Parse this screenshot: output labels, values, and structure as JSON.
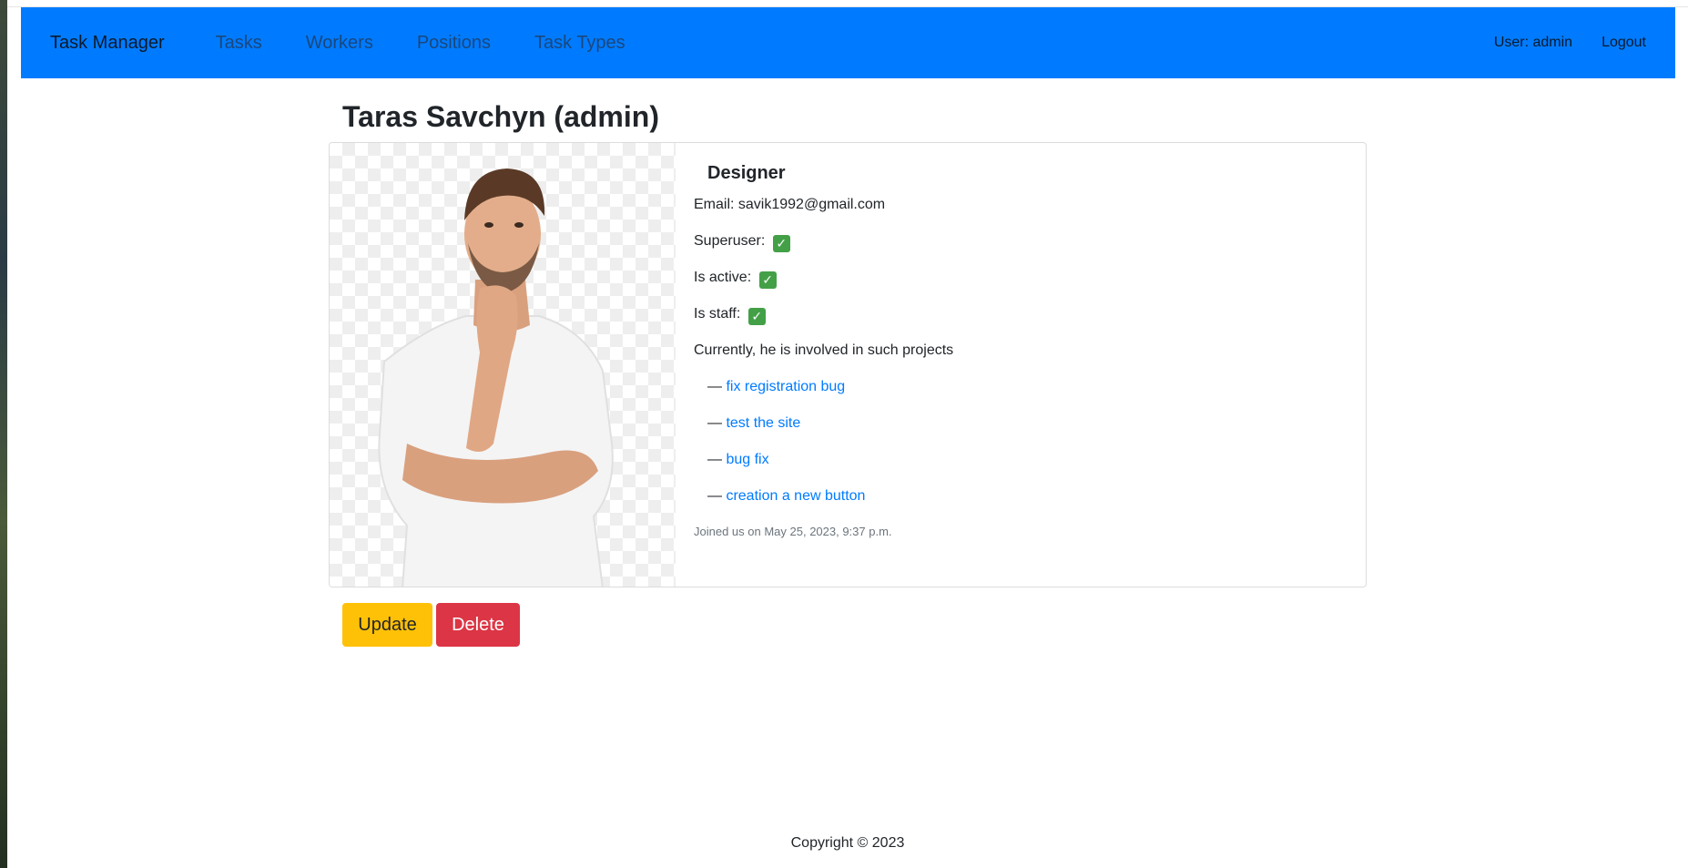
{
  "navbar": {
    "brand": "Task Manager",
    "links": [
      {
        "label": "Tasks"
      },
      {
        "label": "Workers"
      },
      {
        "label": "Positions"
      },
      {
        "label": "Task Types"
      }
    ],
    "user_label": "User: admin",
    "logout_label": "Logout",
    "color": "#007bff"
  },
  "worker": {
    "title": "Taras Savchyn (admin)",
    "position": "Designer",
    "email_line": "Email: savik1992@gmail.com",
    "superuser_label": "Superuser:",
    "active_label": "Is active:",
    "staff_label": "Is staff:",
    "check_icon": "check-mark-icon",
    "projects_intro": "Currently, he is involved in such projects",
    "projects": [
      {
        "dash": "—",
        "name": "fix registration bug"
      },
      {
        "dash": "—",
        "name": "test the site"
      },
      {
        "dash": "—",
        "name": "bug fix"
      },
      {
        "dash": "—",
        "name": "creation a new button"
      }
    ],
    "joined": "Joined us on May 25, 2023, 9:37 p.m."
  },
  "actions": {
    "update_label": "Update",
    "delete_label": "Delete",
    "update_color": "#ffc107",
    "delete_color": "#dc3545"
  },
  "footer": {
    "copyright": "Copyright © 2023"
  }
}
